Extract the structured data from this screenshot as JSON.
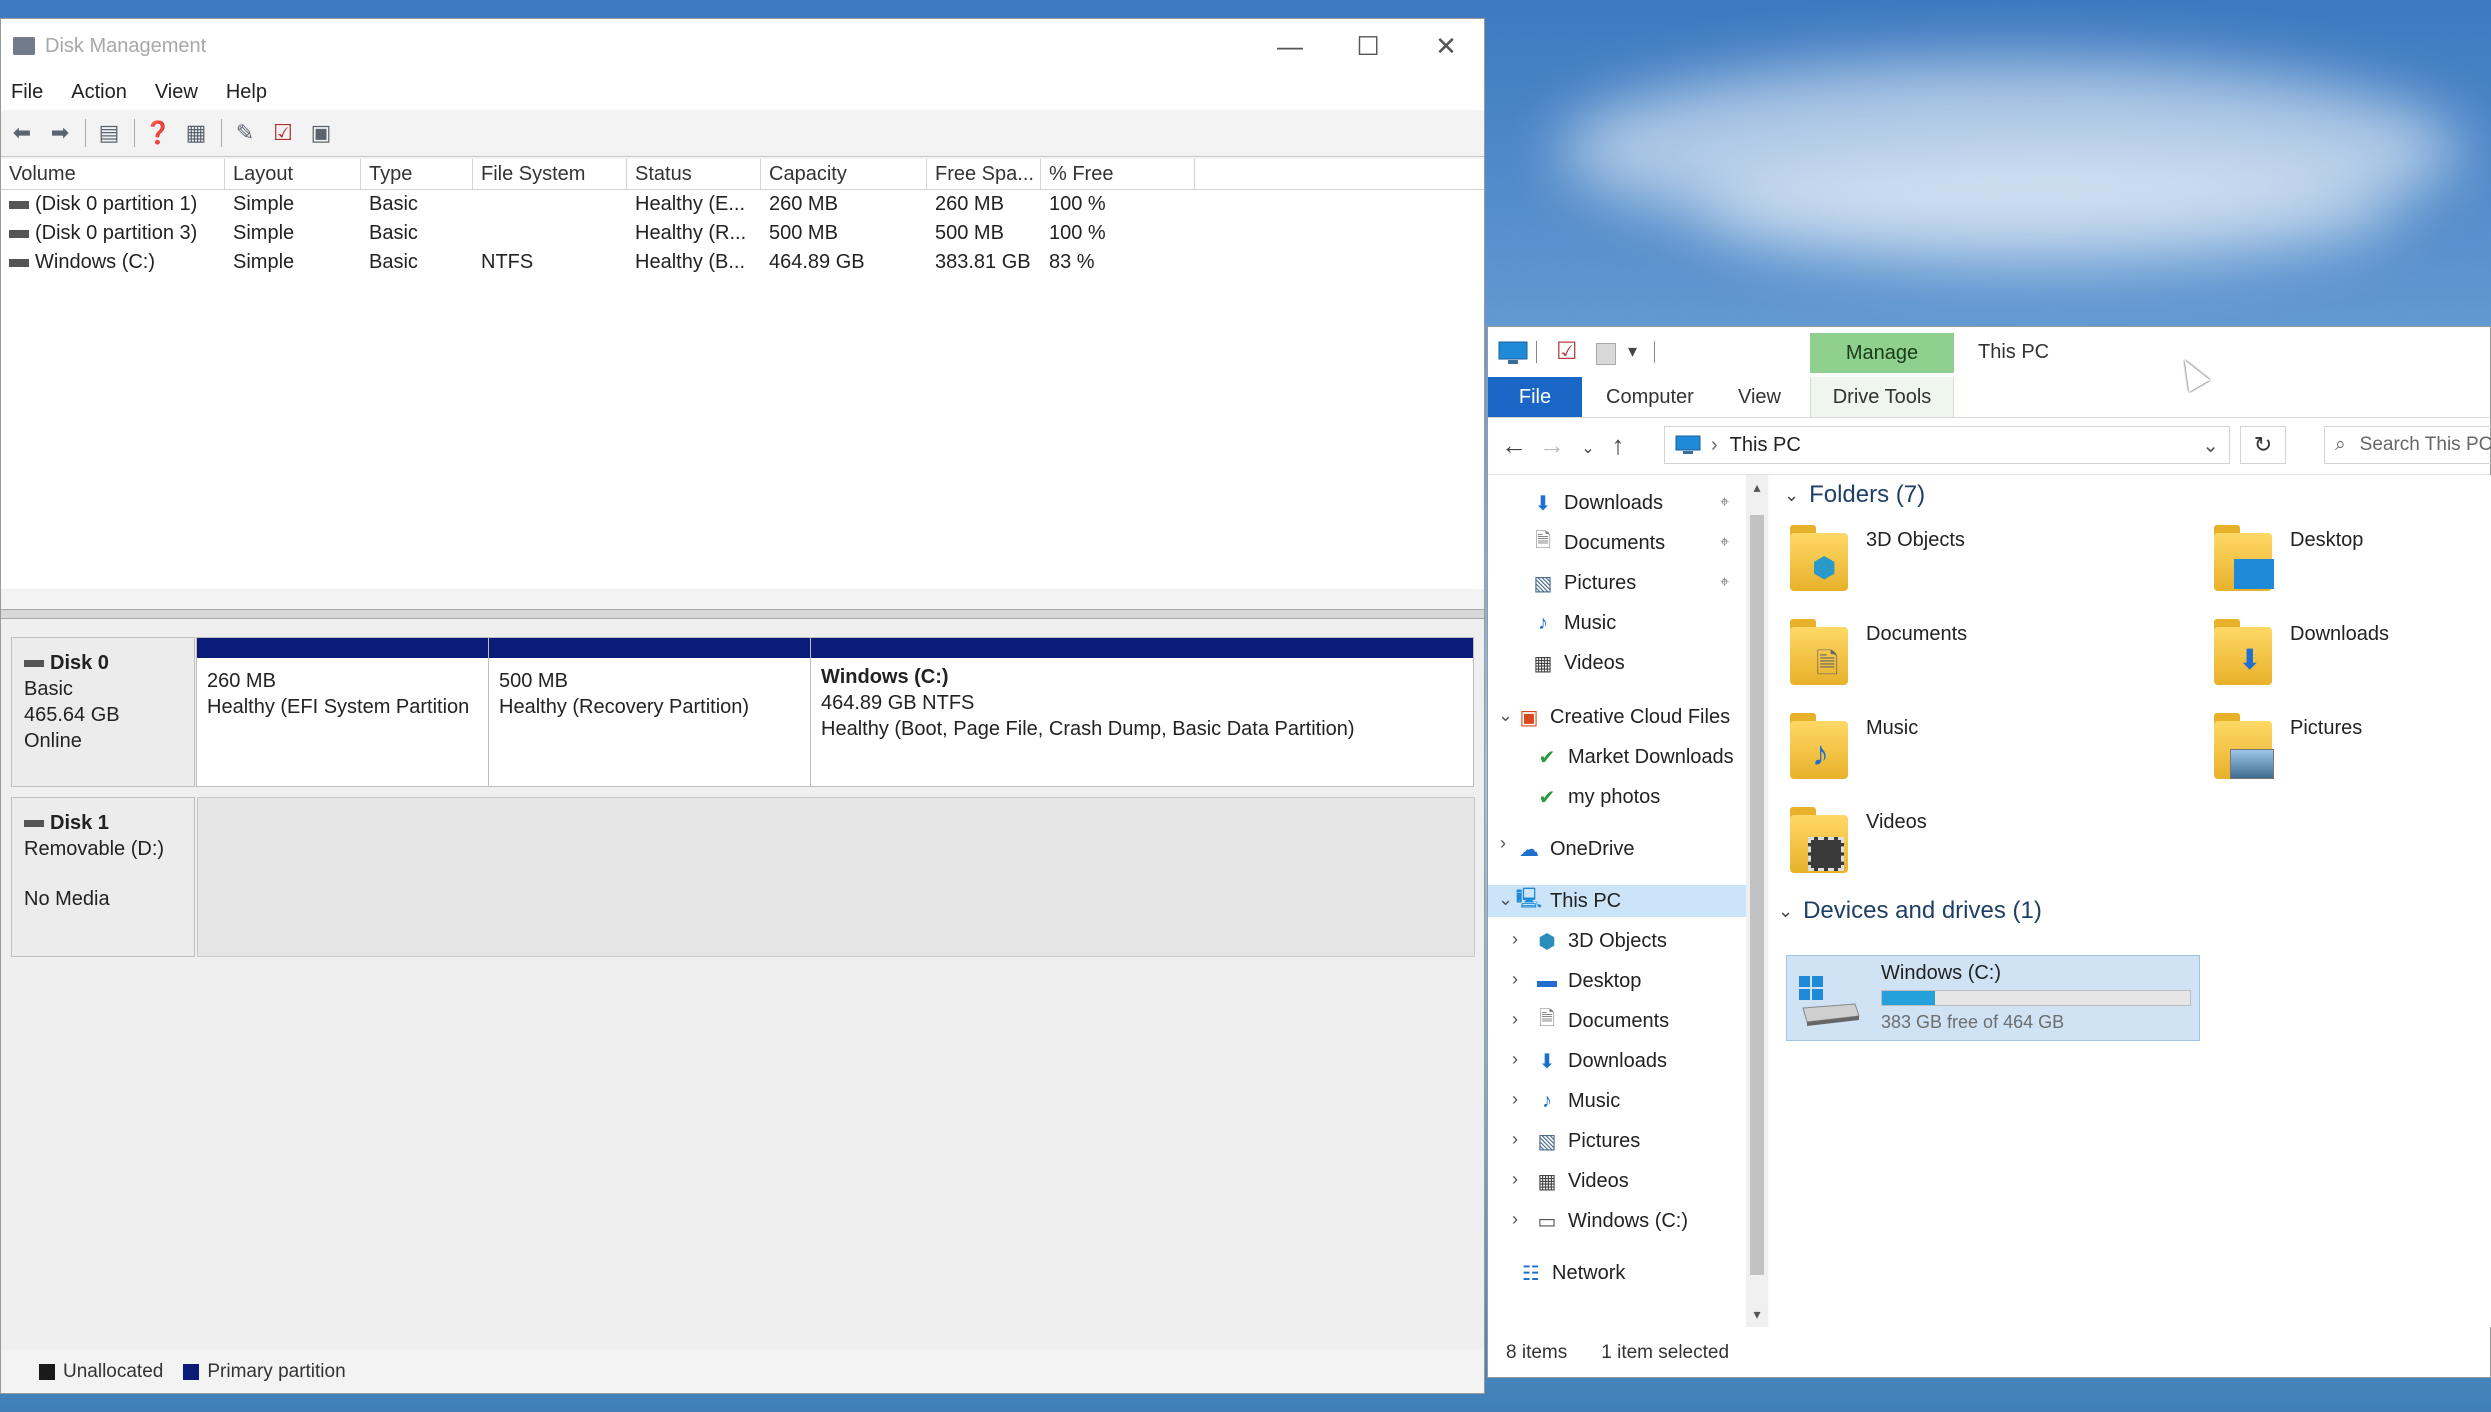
{
  "disk_management": {
    "title": "Disk Management",
    "menu": [
      "File",
      "Action",
      "View",
      "Help"
    ],
    "window_controls": {
      "minimize": "—",
      "maximize": "☐",
      "close": "✕"
    },
    "columns": [
      "Volume",
      "Layout",
      "Type",
      "File System",
      "Status",
      "Capacity",
      "Free Spa...",
      "% Free"
    ],
    "volumes": [
      {
        "volume": "(Disk 0 partition 1)",
        "layout": "Simple",
        "type": "Basic",
        "fs": "",
        "status": "Healthy (E...",
        "capacity": "260 MB",
        "free": "260 MB",
        "pct": "100 %"
      },
      {
        "volume": "(Disk 0 partition 3)",
        "layout": "Simple",
        "type": "Basic",
        "fs": "",
        "status": "Healthy (R...",
        "capacity": "500 MB",
        "free": "500 MB",
        "pct": "100 %"
      },
      {
        "volume": "Windows (C:)",
        "layout": "Simple",
        "type": "Basic",
        "fs": "NTFS",
        "status": "Healthy (B...",
        "capacity": "464.89 GB",
        "free": "383.81 GB",
        "pct": "83 %"
      }
    ],
    "disk0": {
      "name": "Disk 0",
      "type": "Basic",
      "size": "465.64 GB",
      "state": "Online",
      "partitions": [
        {
          "name": "",
          "size": "260 MB",
          "status": "Healthy (EFI System Partition"
        },
        {
          "name": "",
          "size": "500 MB",
          "status": "Healthy (Recovery Partition)"
        },
        {
          "name": "Windows  (C:)",
          "size": "464.89 GB NTFS",
          "status": "Healthy (Boot, Page File, Crash Dump, Basic Data Partition)"
        }
      ]
    },
    "disk1": {
      "name": "Disk 1",
      "type": "Removable (D:)",
      "state": "No Media"
    },
    "legend": [
      {
        "label": "Unallocated",
        "color": "#1a1a1a"
      },
      {
        "label": "Primary partition",
        "color": "#0b1c78"
      }
    ]
  },
  "explorer": {
    "title": "This PC",
    "manage_tab": "Manage",
    "drive_tools_tab": "Drive Tools",
    "ribbon_tabs": {
      "file": "File",
      "computer": "Computer",
      "view": "View"
    },
    "address": "This PC",
    "search_placeholder": "Search This PC",
    "nav": {
      "quick_access": [
        {
          "label": "Downloads",
          "icon": "download-arrow-icon"
        },
        {
          "label": "Documents",
          "icon": "document-icon"
        },
        {
          "label": "Pictures",
          "icon": "pictures-icon"
        },
        {
          "label": "Music",
          "icon": "music-note-icon"
        },
        {
          "label": "Videos",
          "icon": "video-icon"
        }
      ],
      "creative_cloud": "Creative Cloud Files",
      "cc_children": [
        "Market Downloads",
        "my photos"
      ],
      "onedrive": "OneDrive",
      "this_pc": "This PC",
      "this_pc_children": [
        "3D Objects",
        "Desktop",
        "Documents",
        "Downloads",
        "Music",
        "Pictures",
        "Videos",
        "Windows (C:)"
      ],
      "network": "Network"
    },
    "folders_header": "Folders (7)",
    "folders": [
      "3D Objects",
      "Desktop",
      "Documents",
      "Downloads",
      "Music",
      "Pictures",
      "Videos"
    ],
    "devices_header": "Devices and drives (1)",
    "drive": {
      "name": "Windows (C:)",
      "free_text": "383 GB free of 464 GB",
      "used_fraction": 0.173
    },
    "status": {
      "items": "8 items",
      "selected": "1 item selected"
    }
  }
}
